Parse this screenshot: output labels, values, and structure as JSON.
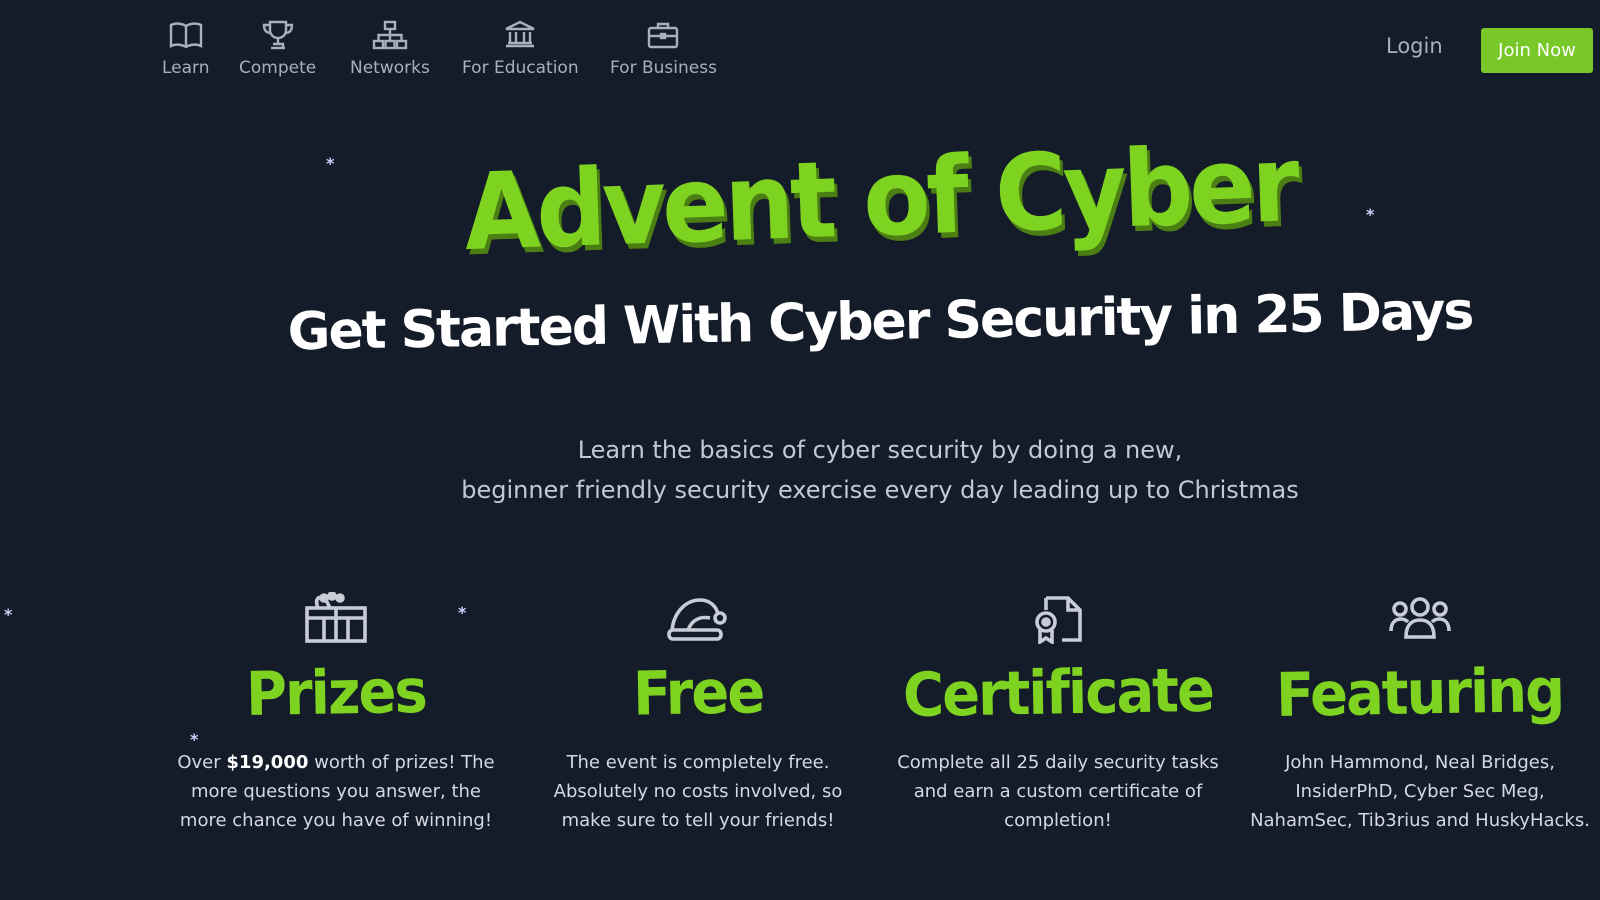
{
  "nav": {
    "items": [
      {
        "label": "Learn",
        "icon": "book-icon"
      },
      {
        "label": "Compete",
        "icon": "trophy-icon"
      },
      {
        "label": "Networks",
        "icon": "network-icon"
      },
      {
        "label": "For Education",
        "icon": "institution-icon"
      },
      {
        "label": "For Business",
        "icon": "briefcase-icon"
      }
    ],
    "login_label": "Login",
    "join_label": "Join Now"
  },
  "hero": {
    "title": "Advent of Cyber",
    "subtitle": "Get Started With Cyber Security in 25 Days",
    "description_line1": "Learn the basics of cyber security by doing a new,",
    "description_line2": "beginner friendly security exercise every day leading up to Christmas"
  },
  "features": [
    {
      "icon": "gift-icon",
      "title": "Prizes",
      "text_before": "Over ",
      "text_bold": "$19,000",
      "text_after": " worth of prizes! The more questions you answer, the more chance you have of winning!"
    },
    {
      "icon": "santa-hat-icon",
      "title": "Free",
      "text": "The event is completely free. Absolutely no costs involved, so make sure to tell your friends!"
    },
    {
      "icon": "certificate-icon",
      "title": "Certificate",
      "text": "Complete all 25 daily security tasks and earn a custom certificate of completion!"
    },
    {
      "icon": "users-icon",
      "title": "Featuring",
      "text": "John Hammond, Neal Bridges, InsiderPhD, Cyber Sec Meg, NahamSec, Tib3rius and HuskyHacks."
    }
  ],
  "decor": {
    "snowflake": "*"
  },
  "colors": {
    "background": "#141b29",
    "accent_green": "#7ed321",
    "button_green": "#78c82a",
    "nav_text": "#a8afbd"
  }
}
